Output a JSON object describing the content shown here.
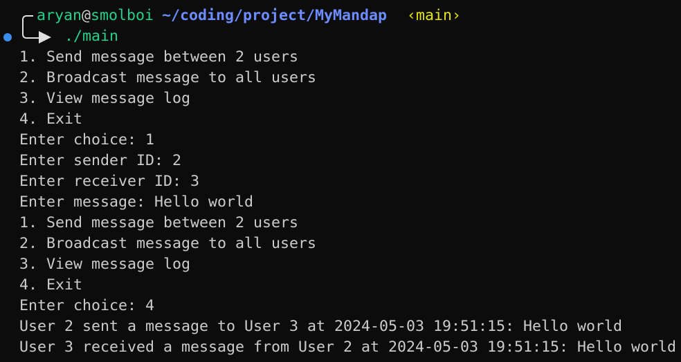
{
  "prompt": {
    "user": "aryan",
    "at": "@",
    "host": "smolboi",
    "path": "~/coding/project/MyMandap",
    "branch": "‹main›",
    "command": "./main"
  },
  "output_lines": [
    "1. Send message between 2 users",
    "2. Broadcast message to all users",
    "3. View message log",
    "4. Exit",
    "Enter choice: 1",
    "Enter sender ID: 2",
    "Enter receiver ID: 3",
    "Enter message: Hello world",
    "1. Send message between 2 users",
    "2. Broadcast message to all users",
    "3. View message log",
    "4. Exit",
    "Enter choice: 4",
    "User 2 sent a message to User 3 at 2024-05-03 19:51:15: Hello world",
    "User 3 received a message from User 2 at 2024-05-03 19:51:15: Hello world"
  ],
  "colors": {
    "background": "#0c0c0c",
    "text": "#cccccc",
    "green": "#23d18b",
    "path_blue": "#6c8cff",
    "branch_yellow": "#e5e510",
    "status_dot": "#3b8eea"
  },
  "icons": {
    "prompt_frame": "box-drawing-frame-icon",
    "prompt_arrow": "right-arrow-icon",
    "status": "status-dot-icon"
  }
}
